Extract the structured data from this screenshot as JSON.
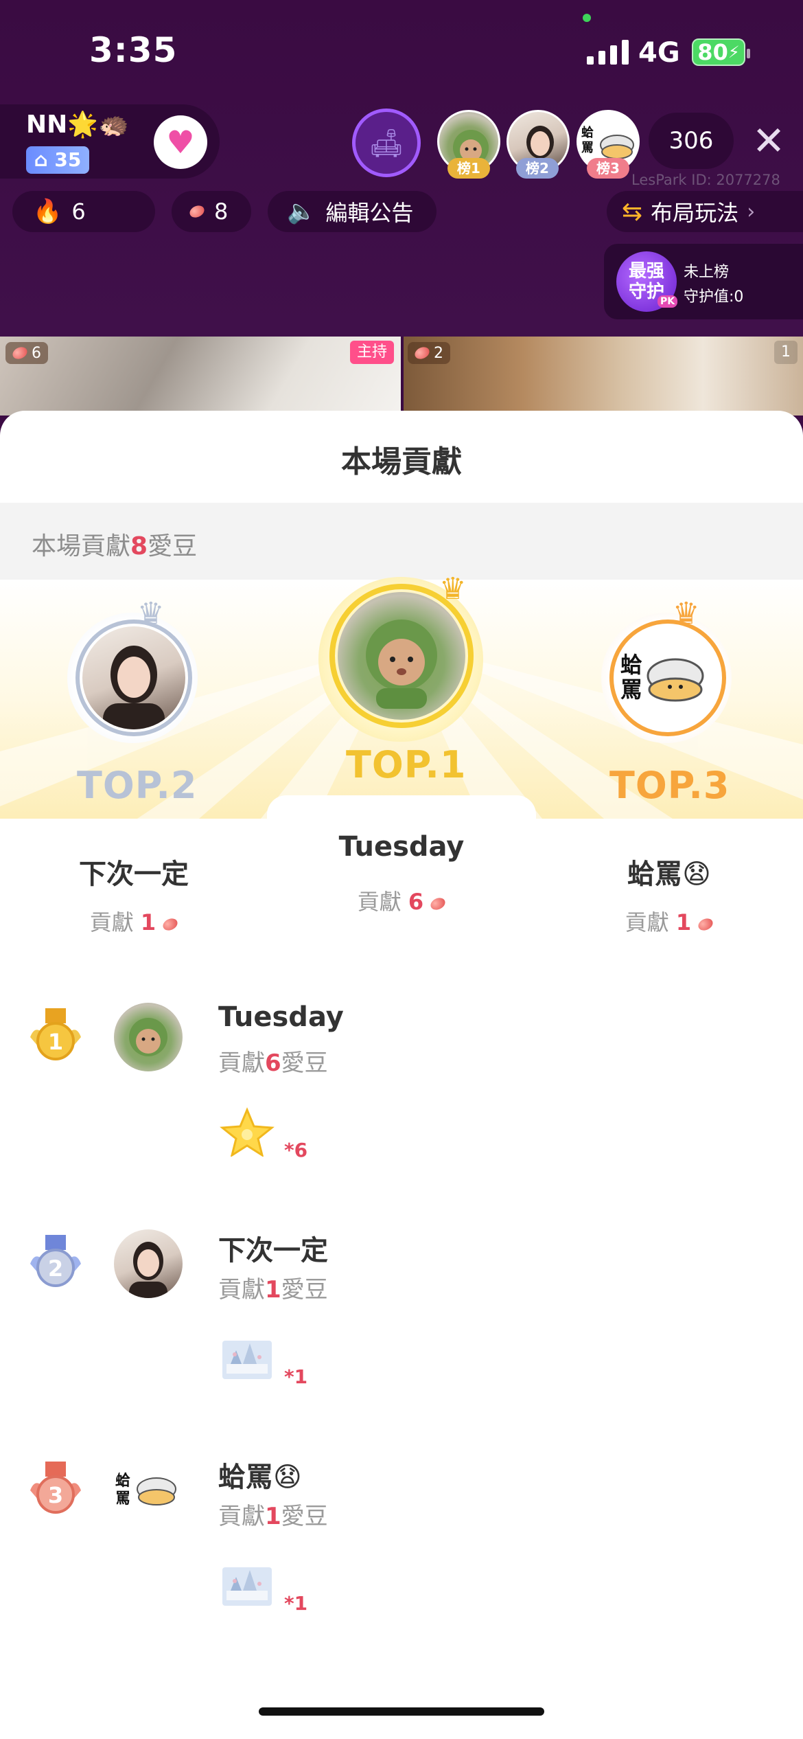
{
  "status_bar": {
    "time": "3:35",
    "network": "4G",
    "battery": "80"
  },
  "host": {
    "name": "NN",
    "name_emoji": "🌟🦔",
    "level": "35"
  },
  "rank_tags": [
    "榜1",
    "榜2",
    "榜3"
  ],
  "viewer_count": "306",
  "room_id": "LesPark ID: 2077278",
  "toolbar": {
    "fire_count": "6",
    "bean_count": "8",
    "announcement": "編輯公告",
    "layout": "布局玩法"
  },
  "guard": {
    "logo_line1": "最强",
    "logo_line2": "守护",
    "logo_badge": "PK",
    "status": "未上榜",
    "value": "守护值:0"
  },
  "video": {
    "left_beans": "6",
    "host_tag": "主持",
    "right_beans": "2",
    "right_seat": "1"
  },
  "sheet": {
    "title": "本場貢獻",
    "summary_prefix": "本場貢獻",
    "summary_value": "8",
    "summary_suffix": "愛豆"
  },
  "podium": [
    {
      "rank_label": "TOP.1",
      "name": "Tuesday",
      "contrib_label": "貢獻",
      "contrib_value": "6"
    },
    {
      "rank_label": "TOP.2",
      "name": "下次一定",
      "contrib_label": "貢獻",
      "contrib_value": "1"
    },
    {
      "rank_label": "TOP.3",
      "name": "蛤罵😧",
      "contrib_label": "貢獻",
      "contrib_value": "1"
    }
  ],
  "list": [
    {
      "rank": "1",
      "name": "Tuesday",
      "contrib_prefix": "貢獻",
      "contrib_value": "6",
      "contrib_suffix": "愛豆",
      "gift_count": "*6",
      "gift_icon": "star-gift-icon"
    },
    {
      "rank": "2",
      "name": "下次一定",
      "contrib_prefix": "貢獻",
      "contrib_value": "1",
      "contrib_suffix": "愛豆",
      "gift_count": "*1",
      "gift_icon": "castle-gift-icon"
    },
    {
      "rank": "3",
      "name": "蛤罵😧",
      "contrib_prefix": "貢獻",
      "contrib_value": "1",
      "contrib_suffix": "愛豆",
      "gift_count": "*1",
      "gift_icon": "castle-gift-icon"
    }
  ],
  "avatar_text": "蛤罵",
  "colors": {
    "accent_pink": "#e3485e",
    "top1_gold": "#f2c230",
    "top2_silver": "#b7c2d6",
    "top3_orange": "#f7a53c",
    "room_bg": "#3b0b43"
  }
}
